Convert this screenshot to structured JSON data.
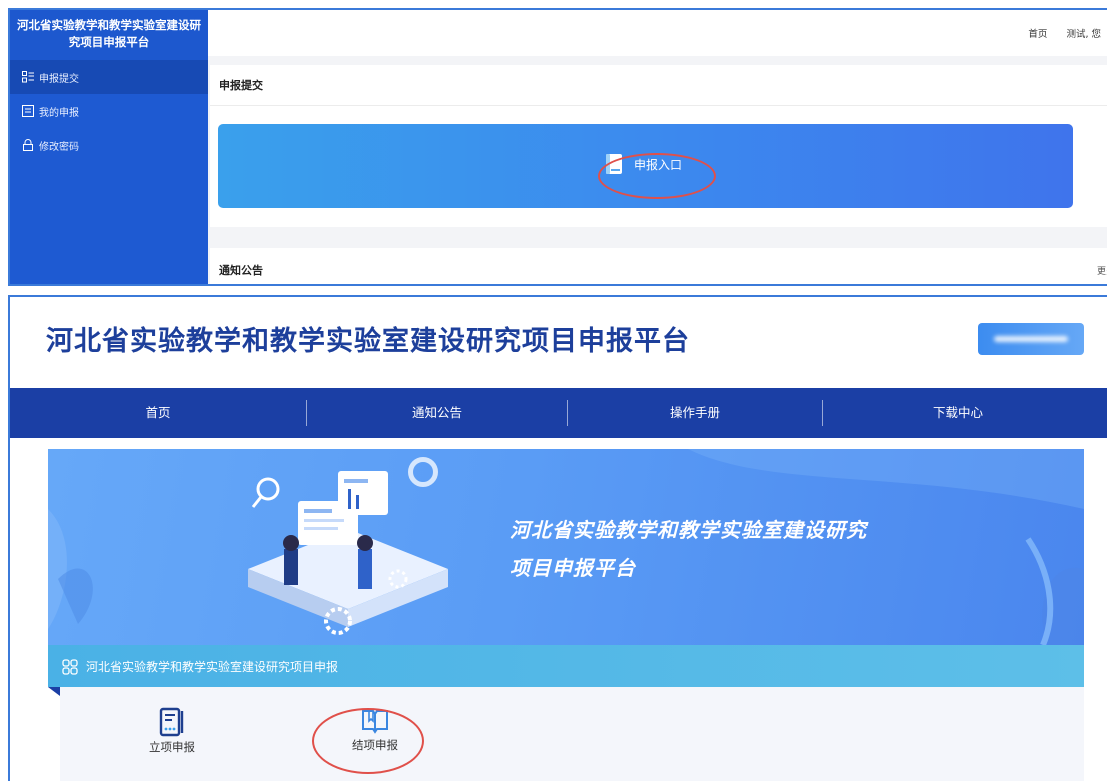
{
  "admin": {
    "sidebar_title_line1": "河北省实验教学和教学实验室建设研",
    "sidebar_title_line2": "究项目申报平台",
    "sidebar_items": [
      {
        "label": "申报提交",
        "icon": "list-icon"
      },
      {
        "label": "我的申报",
        "icon": "document-icon"
      },
      {
        "label": "修改密码",
        "icon": "lock-icon"
      }
    ],
    "top_links": [
      "首页",
      "测试, 您"
    ],
    "submit_card_title": "申报提交",
    "entry_label": "申报入口",
    "entry_icon": "book-icon",
    "notice_card_title": "通知公告",
    "more_link": "更多"
  },
  "portal": {
    "site_title": "河北省实验教学和教学实验室建设研究项目申报平台",
    "nav_items": [
      "首页",
      "通知公告",
      "操作手册",
      "下载中心"
    ],
    "banner_line1": "河北省实验教学和教学实验室建设研究",
    "banner_line2": "项目申报平台",
    "section_title": "河北省实验教学和教学实验室建设研究项目申报",
    "section_icon": "grid-icon",
    "tiles": [
      {
        "label": "立项申报",
        "icon": "application-form-icon"
      },
      {
        "label": "结项申报",
        "icon": "open-book-icon"
      }
    ]
  },
  "colors": {
    "sidebar_blue": "#1e5ad2",
    "nav_blue": "#1b3fa5",
    "title_blue": "#1d3f9b",
    "highlight_red": "#e0504a"
  }
}
